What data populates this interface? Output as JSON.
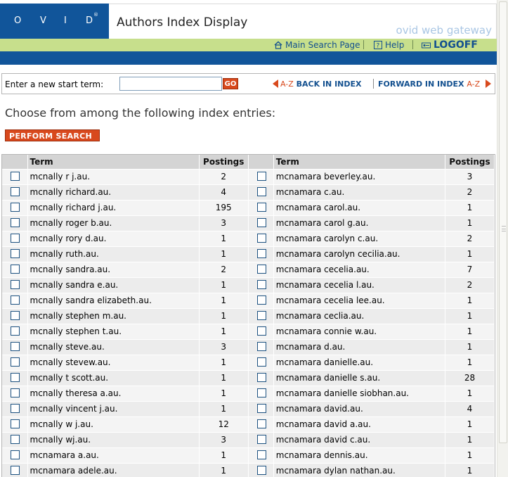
{
  "header": {
    "logo_letters": [
      "O",
      "V",
      "I",
      "D"
    ],
    "logo_mark": "®",
    "title": "Authors Index Display",
    "brand": "ovid web gateway",
    "links": {
      "main_search": "Main Search Page",
      "help": "Help",
      "logoff": "LOGOFF"
    }
  },
  "search": {
    "label": "Enter a new start term:",
    "value": "",
    "go_label": "GO",
    "back_prefix": "A-Z",
    "back_label": "BACK IN INDEX",
    "forward_label": "FORWARD IN INDEX",
    "forward_suffix": "A-Z"
  },
  "instructions": "Choose from among the following index entries:",
  "perform_label": "PERFORM SEARCH »",
  "table": {
    "headers": {
      "term": "Term",
      "postings": "Postings"
    },
    "left": [
      {
        "term": "mcnally r j.au.",
        "postings": "2"
      },
      {
        "term": "mcnally richard.au.",
        "postings": "4"
      },
      {
        "term": "mcnally richard j.au.",
        "postings": "195"
      },
      {
        "term": "mcnally roger b.au.",
        "postings": "3"
      },
      {
        "term": "mcnally rory d.au.",
        "postings": "1"
      },
      {
        "term": "mcnally ruth.au.",
        "postings": "1"
      },
      {
        "term": "mcnally sandra.au.",
        "postings": "2"
      },
      {
        "term": "mcnally sandra e.au.",
        "postings": "1"
      },
      {
        "term": "mcnally sandra elizabeth.au.",
        "postings": "1"
      },
      {
        "term": "mcnally stephen m.au.",
        "postings": "1"
      },
      {
        "term": "mcnally stephen t.au.",
        "postings": "1"
      },
      {
        "term": "mcnally steve.au.",
        "postings": "3"
      },
      {
        "term": "mcnally stevew.au.",
        "postings": "1"
      },
      {
        "term": "mcnally t scott.au.",
        "postings": "1"
      },
      {
        "term": "mcnally theresa a.au.",
        "postings": "1"
      },
      {
        "term": "mcnally vincent j.au.",
        "postings": "1"
      },
      {
        "term": "mcnally w j.au.",
        "postings": "12"
      },
      {
        "term": "mcnally wj.au.",
        "postings": "3"
      },
      {
        "term": "mcnamara a.au.",
        "postings": "1"
      },
      {
        "term": "mcnamara adele.au.",
        "postings": "1"
      }
    ],
    "right": [
      {
        "term": "mcnamara beverley.au.",
        "postings": "3"
      },
      {
        "term": "mcnamara c.au.",
        "postings": "2"
      },
      {
        "term": "mcnamara carol.au.",
        "postings": "1"
      },
      {
        "term": "mcnamara carol g.au.",
        "postings": "1"
      },
      {
        "term": "mcnamara carolyn c.au.",
        "postings": "2"
      },
      {
        "term": "mcnamara carolyn cecilia.au.",
        "postings": "1"
      },
      {
        "term": "mcnamara cecelia.au.",
        "postings": "7"
      },
      {
        "term": "mcnamara cecelia l.au.",
        "postings": "2"
      },
      {
        "term": "mcnamara cecelia lee.au.",
        "postings": "1"
      },
      {
        "term": "mcnamara ceclia.au.",
        "postings": "1"
      },
      {
        "term": "mcnamara connie w.au.",
        "postings": "1"
      },
      {
        "term": "mcnamara d.au.",
        "postings": "1"
      },
      {
        "term": "mcnamara danielle.au.",
        "postings": "1"
      },
      {
        "term": "mcnamara danielle s.au.",
        "postings": "28"
      },
      {
        "term": "mcnamara danielle siobhan.au.",
        "postings": "1"
      },
      {
        "term": "mcnamara david.au.",
        "postings": "4"
      },
      {
        "term": "mcnamara david a.au.",
        "postings": "1"
      },
      {
        "term": "mcnamara david c.au.",
        "postings": "1"
      },
      {
        "term": "mcnamara dennis.au.",
        "postings": "1"
      },
      {
        "term": "mcnamara dylan nathan.au.",
        "postings": "1"
      }
    ]
  }
}
